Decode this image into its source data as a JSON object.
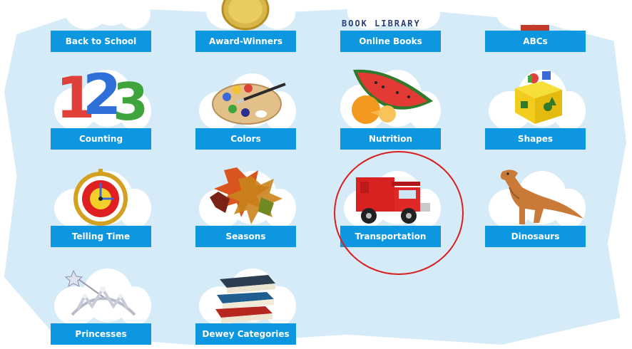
{
  "tiles": [
    {
      "label": "Back to School",
      "icon": "school-icon"
    },
    {
      "label": "Award-Winners",
      "icon": "medal-icon"
    },
    {
      "label": "Online Books",
      "icon": "book-library-icon",
      "icon_text": "BOOK LIBRARY"
    },
    {
      "label": "ABCs",
      "icon": "abc-blocks-icon"
    },
    {
      "label": "Counting",
      "icon": "numbers-123-icon"
    },
    {
      "label": "Colors",
      "icon": "paint-palette-icon"
    },
    {
      "label": "Nutrition",
      "icon": "watermelon-icon"
    },
    {
      "label": "Shapes",
      "icon": "shape-sorter-icon"
    },
    {
      "label": "Telling Time",
      "icon": "clock-icon"
    },
    {
      "label": "Seasons",
      "icon": "autumn-leaves-icon"
    },
    {
      "label": "Transportation",
      "icon": "fire-truck-icon"
    },
    {
      "label": "Dinosaurs",
      "icon": "dinosaur-icon"
    },
    {
      "label": "Princesses",
      "icon": "tiara-icon"
    },
    {
      "label": "Dewey Categories",
      "icon": "book-stack-icon"
    }
  ],
  "highlighted": "Transportation",
  "colors": {
    "background": "#d6ebf8",
    "label_bar": "#0d97e0",
    "highlight_circle": "#d91e1e"
  }
}
